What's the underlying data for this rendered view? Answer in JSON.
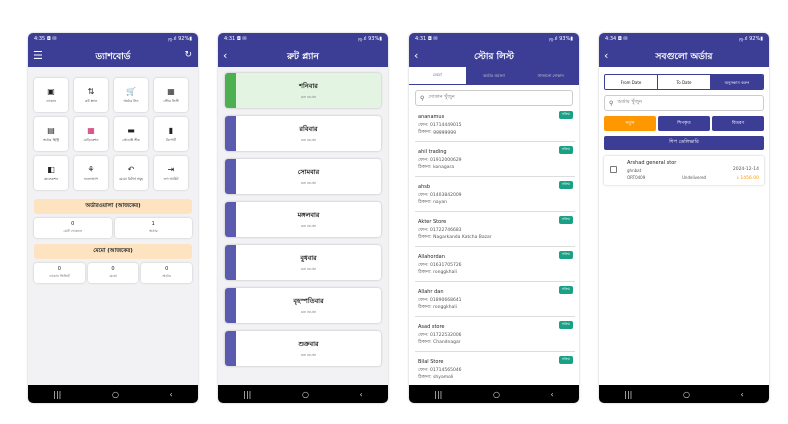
{
  "navbar": {
    "recent": "|||",
    "home": "○",
    "back": "‹"
  },
  "phone1": {
    "status": {
      "time": "4:35 ◘ ✉",
      "right": "ஜ.ıl 92%▮"
    },
    "appbar": {
      "menu": "☰",
      "title": "ড্যাশবোর্ড",
      "refresh": "↻"
    },
    "tiles": [
      {
        "icon": "▣",
        "label": "দোকান"
      },
      {
        "icon": "⇅",
        "label": "রুট প্ল্যান"
      },
      {
        "icon": "🛒",
        "label": "অর্ডার নিন"
      },
      {
        "icon": "▦",
        "label": "স্টোর লিস্ট"
      },
      {
        "icon": "▤",
        "label": "অর্ডার হিস্ট্রি"
      },
      {
        "icon": "▦",
        "label": "মেডিকেশন"
      },
      {
        "icon": "▬",
        "label": "প্রোডাক্ট স্টক"
      },
      {
        "icon": "▮",
        "label": "রিপোর্ট"
      },
      {
        "icon": "◧",
        "label": "কালেকশন"
      },
      {
        "icon": "⚘",
        "label": "ফলোআপ"
      },
      {
        "icon": "↶",
        "label": "মেমো রিটার্ন সমূহ"
      },
      {
        "icon": "⇥",
        "label": "লগ আউট"
      }
    ],
    "banner1": "অর্ডারওয়ালা (আজকের)",
    "stats1": [
      {
        "value": "0",
        "label": "মোট দোকানে"
      },
      {
        "value": "1",
        "label": "অর্ডার"
      }
    ],
    "banner2": "মেমো (আজকের)",
    "stats2": [
      {
        "value": "0",
        "label": "দোকান ভিজিট"
      },
      {
        "value": "0",
        "label": "মেমো"
      },
      {
        "value": "0",
        "label": "অর্ডার"
      }
    ]
  },
  "phone2": {
    "status": {
      "time": "4:31 ◘ ✉",
      "right": "ஜ.ıl 93%▮"
    },
    "appbar": {
      "back": "‹",
      "title": "রুট প্ল্যান"
    },
    "routes": [
      {
        "name": "শনিবার",
        "sub": "ow route"
      },
      {
        "name": "রবিবার",
        "sub": "ow route"
      },
      {
        "name": "সোমবার",
        "sub": "ow route"
      },
      {
        "name": "মঙ্গলবার",
        "sub": "ow route"
      },
      {
        "name": "বুধবার",
        "sub": "ow route"
      },
      {
        "name": "বৃহস্পতিবার",
        "sub": "ow route"
      },
      {
        "name": "শুক্রবার",
        "sub": "ow route"
      }
    ]
  },
  "phone3": {
    "status": {
      "time": "4:31 ◘ ✉",
      "right": "ஜ.ıl 93%▮"
    },
    "appbar": {
      "back": "‹",
      "title": "স্টোর লিস্ট"
    },
    "tabs": [
      "মেমো",
      "অর্ডার ওয়ালা",
      "সাজানো দোকান"
    ],
    "search": {
      "icon": "⚲",
      "placeholder": "দোকান খুঁজুন"
    },
    "shops": [
      {
        "name": "ananamus",
        "phone": "ফোন: 01714449015",
        "address": "ঠিকানা: gggggggg",
        "badge": "সক্রিয়"
      },
      {
        "name": "ahil trading",
        "phone": "ফোন: 01912000629",
        "address": "ঠিকানা: konagara",
        "badge": "সক্রিয়"
      },
      {
        "name": "ahsb",
        "phone": "ফোন: 01403842009",
        "address": "ঠিকানা: nayan",
        "badge": "সক্রিয়"
      },
      {
        "name": "Akter Store",
        "phone": "ফোন: 01722746683",
        "address": "ঠিকানা: Nagarkanda Katcha Bazar",
        "badge": "সক্রিয়"
      },
      {
        "name": "Allahordan",
        "phone": "ফোন: 01631705726",
        "address": "ঠিকানা: ronggkhali",
        "badge": "সক্রিয়"
      },
      {
        "name": "Allahr dan",
        "phone": "ফোন: 01890668641",
        "address": "ঠিকানা: ronggkhali",
        "badge": "সক্রিয়"
      },
      {
        "name": "Asad store",
        "phone": "ফোন: 01722532006",
        "address": "ঠিকানা: Chandnagar",
        "badge": "সক্রিয়"
      },
      {
        "name": "Bilal Store",
        "phone": "ফোন: 01714565046",
        "address": "ঠিকানা: shyamoli",
        "badge": "সক্রিয়"
      }
    ]
  },
  "phone4": {
    "status": {
      "time": "4:34 ◘ ✉",
      "right": "ஜ.ıl 92%▮"
    },
    "appbar": {
      "back": "‹",
      "title": "সবগুলো অর্ডার"
    },
    "date_controls": {
      "from": "From Date",
      "to": "To Date",
      "search": "অনুসন্ধান করুন"
    },
    "search": {
      "icon": "⚲",
      "placeholder": "অর্ডার খুঁজুন"
    },
    "filters": [
      "নতুন",
      "শিপকৃত",
      "বিতরণ"
    ],
    "select_button": "শিপ ডেলিভারি",
    "orders": [
      {
        "name": "Arshad general stor",
        "customer": "ghnbat",
        "order_id": "ORT0409",
        "status": "Undelivered",
        "date": "2024-12-14",
        "amount": "৳ 1456.00"
      }
    ]
  }
}
